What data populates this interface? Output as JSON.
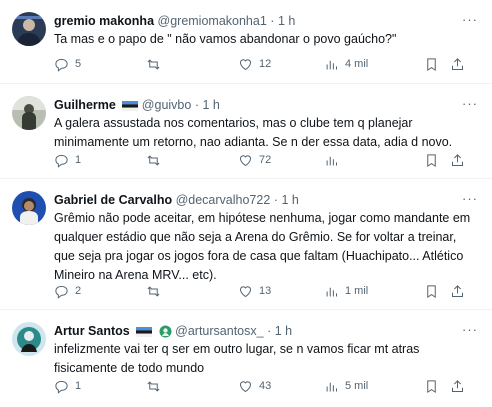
{
  "icons": {
    "reply": "reply-icon",
    "retweet": "retweet-icon",
    "like": "like-icon",
    "views": "views-icon",
    "bookmark": "bookmark-icon",
    "share": "share-icon",
    "more": "more-icon"
  },
  "colors": {
    "text": "#0f1419",
    "secondary": "#536471",
    "divider": "#eff3f4"
  },
  "tweets": [
    {
      "name": "gremio makonha",
      "handle": "@gremiomakonha1",
      "dot": "·",
      "time": "1 h",
      "text": "Ta mas e o papo de \" não vamos abandonar o povo gaúcho?\"",
      "replies": "5",
      "retweets": "",
      "likes": "12",
      "views": "4 mil",
      "more": "···"
    },
    {
      "name": "Guilherme",
      "handle": "@guivbo",
      "dot": "·",
      "time": "1 h",
      "text": "A galera assustada nos comentarios, mas o clube tem q planejar minimamente um retorno, nao adianta. Se n der essa data, adia d novo.",
      "replies": "1",
      "retweets": "",
      "likes": "72",
      "views": "",
      "more": "···"
    },
    {
      "name": "Gabriel de Carvalho",
      "handle": "@decarvalho722",
      "dot": "·",
      "time": "1 h",
      "text": "Grêmio não pode aceitar, em hipótese nenhuma, jogar como mandante em qualquer estádio que não seja a Arena do Grêmio. Se for voltar a treinar, que seja pra jogar os jogos fora de casa que faltam (Huachipato... Atlético Mineiro na Arena MRV... etc).",
      "replies": "2",
      "retweets": "",
      "likes": "13",
      "views": "1 mil",
      "more": "···"
    },
    {
      "name": "Artur Santos",
      "handle": "@artursantosx_",
      "dot": "·",
      "time": "1 h",
      "text": "infelizmente vai ter q ser em outro lugar, se n vamos ficar mt atras fisicamente de todo mundo",
      "replies": "1",
      "retweets": "",
      "likes": "43",
      "views": "5 mil",
      "more": "···"
    }
  ]
}
